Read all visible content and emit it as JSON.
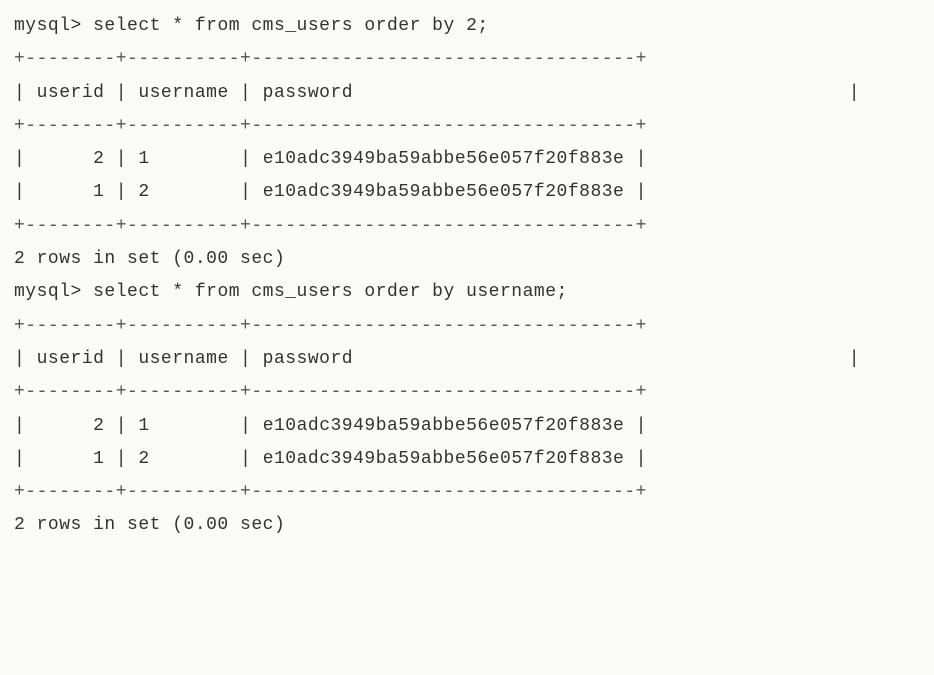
{
  "prompt": "mysql> ",
  "queries": [
    {
      "sql": "select * from cms_users order by 2;",
      "border": "+--------+----------+----------------------------------+",
      "columns": [
        "userid",
        "username",
        "password"
      ],
      "rows": [
        {
          "userid": "2",
          "username": "1",
          "password": "e10adc3949ba59abbe56e057f20f883e"
        },
        {
          "userid": "1",
          "username": "2",
          "password": "e10adc3949ba59abbe56e057f20f883e"
        }
      ],
      "status": "2 rows in set (0.00 sec)"
    },
    {
      "sql": "select * from cms_users order by username;",
      "border": "+--------+----------+----------------------------------+",
      "columns": [
        "userid",
        "username",
        "password"
      ],
      "rows": [
        {
          "userid": "2",
          "username": "1",
          "password": "e10adc3949ba59abbe56e057f20f883e"
        },
        {
          "userid": "1",
          "username": "2",
          "password": "e10adc3949ba59abbe56e057f20f883e"
        }
      ],
      "status": "2 rows in set (0.00 sec)"
    }
  ],
  "pipe": "|"
}
